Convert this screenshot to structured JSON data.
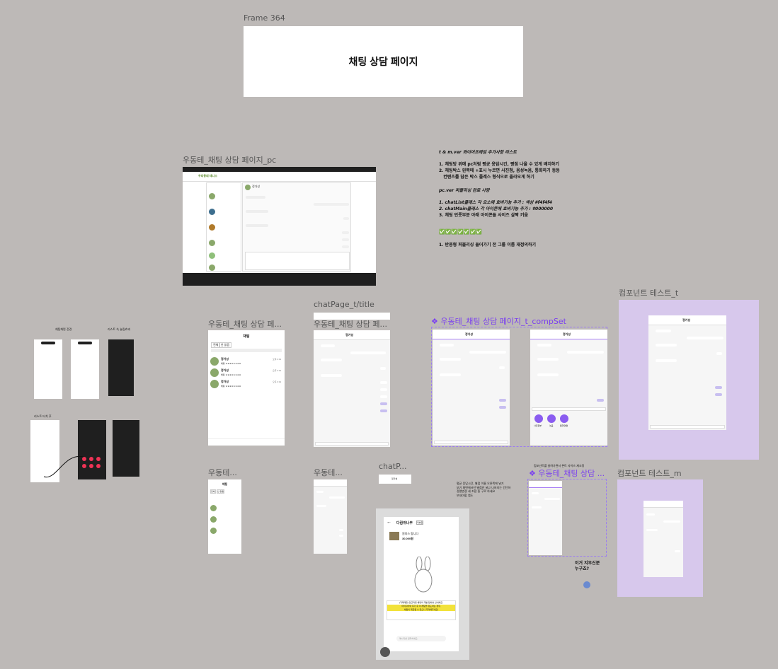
{
  "frames": {
    "frame364": {
      "label": "Frame 364",
      "title": "채팅 상담 페이지"
    },
    "pc": {
      "label": "우동테_채팅 상담 페이지_pc",
      "header_logo": "우리동네 테니스",
      "chat_name": "정가성"
    },
    "tablet_list": {
      "label": "우동테_채팅 상담 페...",
      "header": "채팅",
      "tab_all": "전체",
      "tab_unread": "안 읽음",
      "items": [
        {
          "name": "정가성",
          "preview": "채팅 ㅎㅎㅎㅎㅎㅎㅎㅎ",
          "time": "오후 3:01"
        },
        {
          "name": "정가성",
          "preview": "채팅 ㅎㅎㅎㅎㅎㅎㅎㅎ",
          "time": "오후 3:01"
        },
        {
          "name": "정가성",
          "preview": "채팅 ㅎㅎㅎㅎㅎㅎㅎㅎ",
          "time": "오후 3:01"
        }
      ]
    },
    "chatpage_title": {
      "label": "chatPage_t/title"
    },
    "tablet_chat": {
      "label": "우동테_채팅 상담 페...",
      "name": "정가성"
    },
    "compset": {
      "label": "❖ 우동테_채팅 상담 페이지_t_compSet",
      "name": "정가성",
      "actions": [
        "사진첨부",
        "녹음",
        "통화연결"
      ]
    },
    "comp_test_t": {
      "label": "컴포넌트 테스트_t",
      "name": "정가성"
    },
    "mobile_list": {
      "label": "우동테...",
      "header": "채팅",
      "tab_all": "전체",
      "tab_unread": "안 읽음"
    },
    "mobile_chat": {
      "label": "우동테..."
    },
    "chatp": {
      "label": "chatP...",
      "name": "정가성"
    },
    "mobile_compset": {
      "label": "❖ 우동테_채팅 상담 ..."
    },
    "comp_test_m": {
      "label": "컴포넌트 테스트_m"
    },
    "left_refs": {
      "label_a": "채팅화면 전경",
      "label_b": "리스트 속 눌림효과",
      "label_c": "리스트 터치 후"
    },
    "daangn": {
      "title": "다람쥐나무",
      "badge": "리뷰중",
      "item": "원피스 팝니다",
      "price": "30,000원",
      "notice_a": "[거래매칭] 당근마켓 채팅의 개발 팀에서 안내해요.",
      "notice_b": "아이디어와 후기 후 이 채팅을 유도하는 경우,",
      "notice_c": "채팅이 제한될 수 있으니 주의해주세요!",
      "input": "메시지를 입력하세요"
    }
  },
  "notes": {
    "todo_title": "t & m.ver 와이어프레임 추가사항 리스트",
    "todo_items": [
      "1. 채팅방 위에 pc처럼 평균 응답시간, 평점 나올 수 있게 배치하기",
      "2. 채팅박스 왼쪽에 +표시 누르면 사진첨, 음성녹음, 통화하기 등등",
      "   컨텐츠를 담은 박스 플레스 형식으로 올라오게 하기"
    ],
    "done_title": "pc.ver 퍼블리싱 완료 사항",
    "done_items": [
      "1. chatList클래스 각 요소에 호버기능 추가 : 색상 #f4f4f4",
      "2. chatMain클래스 각 아이콘에 호버기능 추가 : #000000",
      "3. 채팅 인풋부분 아래 아이콘들 사이즈 살짝 키움"
    ],
    "checks": "✅✅✅✅✅✅✅",
    "final": "1. 반응형 퍼블리싱 들어가기 전 그룹 이름 재정의하기",
    "side_notes": [
      "평균 응답시간, 별점 이름 오른쪽에 넣기",
      "보기 화면에서만 별점만 넣고 나머지는 간단하",
      "정렬변경 세 조합 중 구로 하세요",
      "보내야할 앱도"
    ],
    "compset_sub": "컴포넌트를 살려가면서 폰트 사이즈 재조정",
    "sticker_a": "이거 지우신분",
    "sticker_b": "누구죠?"
  }
}
